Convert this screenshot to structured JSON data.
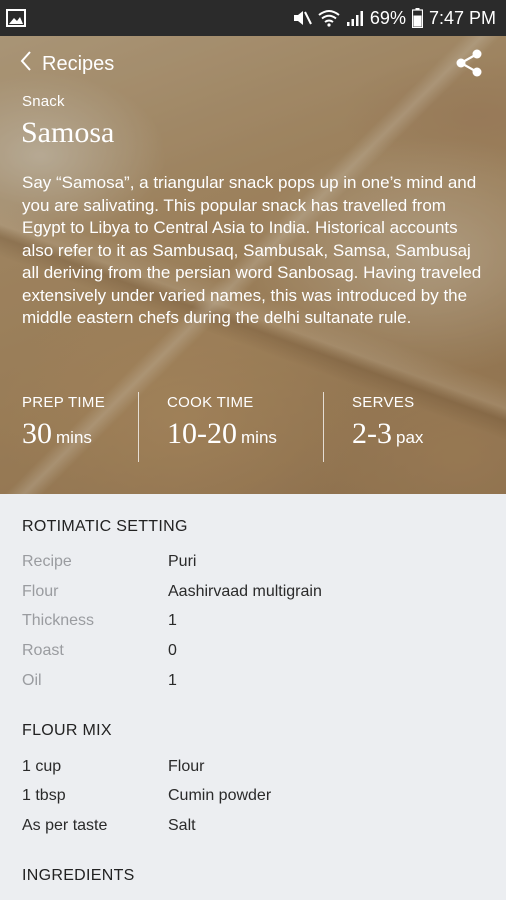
{
  "status_bar": {
    "battery": "69%",
    "time": "7:47 PM"
  },
  "header": {
    "back_label": "Recipes"
  },
  "recipe": {
    "category": "Snack",
    "title": "Samosa",
    "description": "Say “Samosa”, a triangular snack pops up in one’s mind and you are salivating. This popular snack has travelled from Egypt to Libya to Central Asia to India. Historical accounts also refer to it as Sambusaq, Sambusak, Samsa, Sambusaj all deriving from the persian word Sanbosag. Having traveled extensively under varied names, this was introduced by the middle eastern chefs during the delhi sultanate rule."
  },
  "stats": [
    {
      "label": "PREP TIME",
      "value": "30",
      "unit": "mins"
    },
    {
      "label": "COOK TIME",
      "value": "10-20",
      "unit": "mins"
    },
    {
      "label": "SERVES",
      "value": "2-3",
      "unit": "pax"
    }
  ],
  "rotimatic": {
    "title": "ROTIMATIC SETTING",
    "rows": [
      {
        "key": "Recipe",
        "value": "Puri"
      },
      {
        "key": "Flour",
        "value": "Aashirvaad multigrain"
      },
      {
        "key": "Thickness",
        "value": "1"
      },
      {
        "key": "Roast",
        "value": "0"
      },
      {
        "key": "Oil",
        "value": "1"
      }
    ]
  },
  "flour_mix": {
    "title": "FLOUR MIX",
    "rows": [
      {
        "key": "1 cup",
        "value": "Flour"
      },
      {
        "key": "1 tbsp",
        "value": "Cumin powder"
      },
      {
        "key": "As per taste",
        "value": "Salt"
      }
    ]
  },
  "ingredients": {
    "title": "INGREDIENTS"
  },
  "colors": {
    "status_bar_bg": "#2b2b2b",
    "content_bg": "#eceef1",
    "muted_label": "#9a9ca0"
  }
}
